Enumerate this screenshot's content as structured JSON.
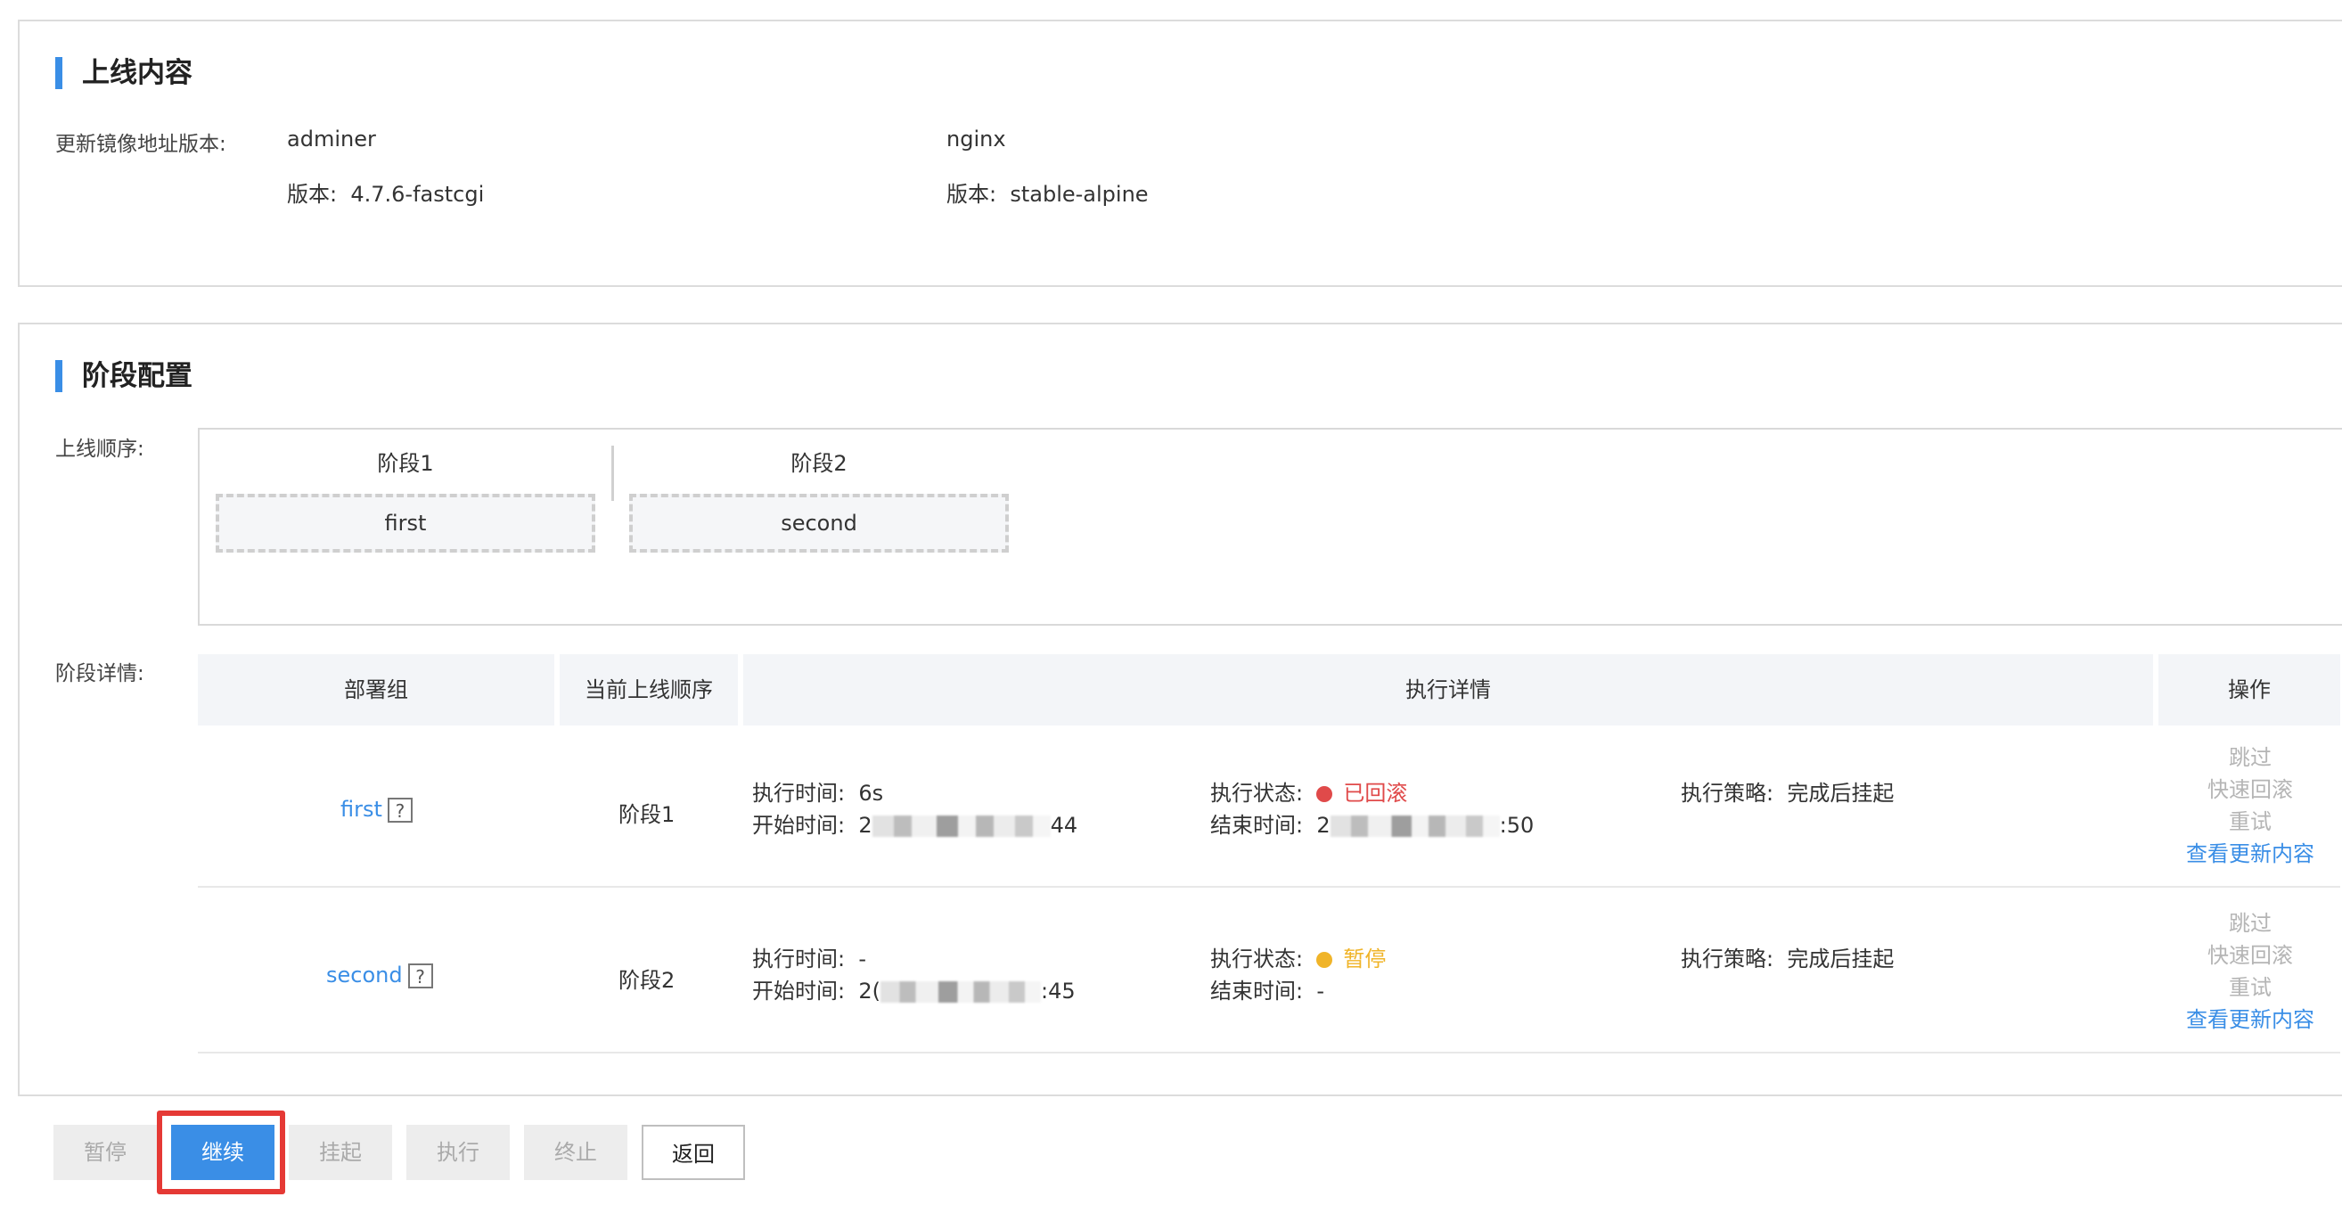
{
  "content_section": {
    "title": "上线内容",
    "image_label": "更新镜像地址版本:",
    "images": [
      {
        "name": "adminer",
        "version_label": "版本:",
        "version": "4.7.6-fastcgi"
      },
      {
        "name": "nginx",
        "version_label": "版本:",
        "version": "stable-alpine"
      }
    ]
  },
  "stage_section": {
    "title": "阶段配置",
    "order_label": "上线顺序:",
    "order": [
      {
        "stage": "阶段1",
        "group": "first"
      },
      {
        "stage": "阶段2",
        "group": "second"
      }
    ],
    "detail_label": "阶段详情:",
    "table": {
      "headers": [
        "部署组",
        "当前上线顺序",
        "执行详情",
        "操作"
      ],
      "rows": [
        {
          "group": "first",
          "help": "?",
          "stage": "阶段1",
          "exec_time_label": "执行时间:",
          "exec_time": "6s",
          "start_time_label": "开始时间:",
          "start_time_prefix": "2",
          "start_time_suffix": "44",
          "status_label": "执行状态:",
          "status": "已回滚",
          "status_color": "#e04a4a",
          "end_time_label": "结束时间:",
          "end_time_prefix": "2",
          "end_time_suffix": ":50",
          "strategy_label": "执行策略:",
          "strategy": "完成后挂起",
          "actions": [
            "跳过",
            "快速回滚",
            "重试",
            "查看更新内容"
          ]
        },
        {
          "group": "second",
          "help": "?",
          "stage": "阶段2",
          "exec_time_label": "执行时间:",
          "exec_time": "-",
          "start_time_label": "开始时间:",
          "start_time_prefix": "2(",
          "start_time_suffix": ":45",
          "status_label": "执行状态:",
          "status": "暂停",
          "status_color": "#f0b429",
          "end_time_label": "结束时间:",
          "end_time_prefix": "-",
          "end_time_suffix": "",
          "strategy_label": "执行策略:",
          "strategy": "完成后挂起",
          "actions": [
            "跳过",
            "快速回滚",
            "重试",
            "查看更新内容"
          ]
        }
      ]
    }
  },
  "buttons": {
    "pause": "暂停",
    "continue": "继续",
    "suspend": "挂起",
    "execute": "执行",
    "terminate": "终止",
    "back": "返回"
  }
}
